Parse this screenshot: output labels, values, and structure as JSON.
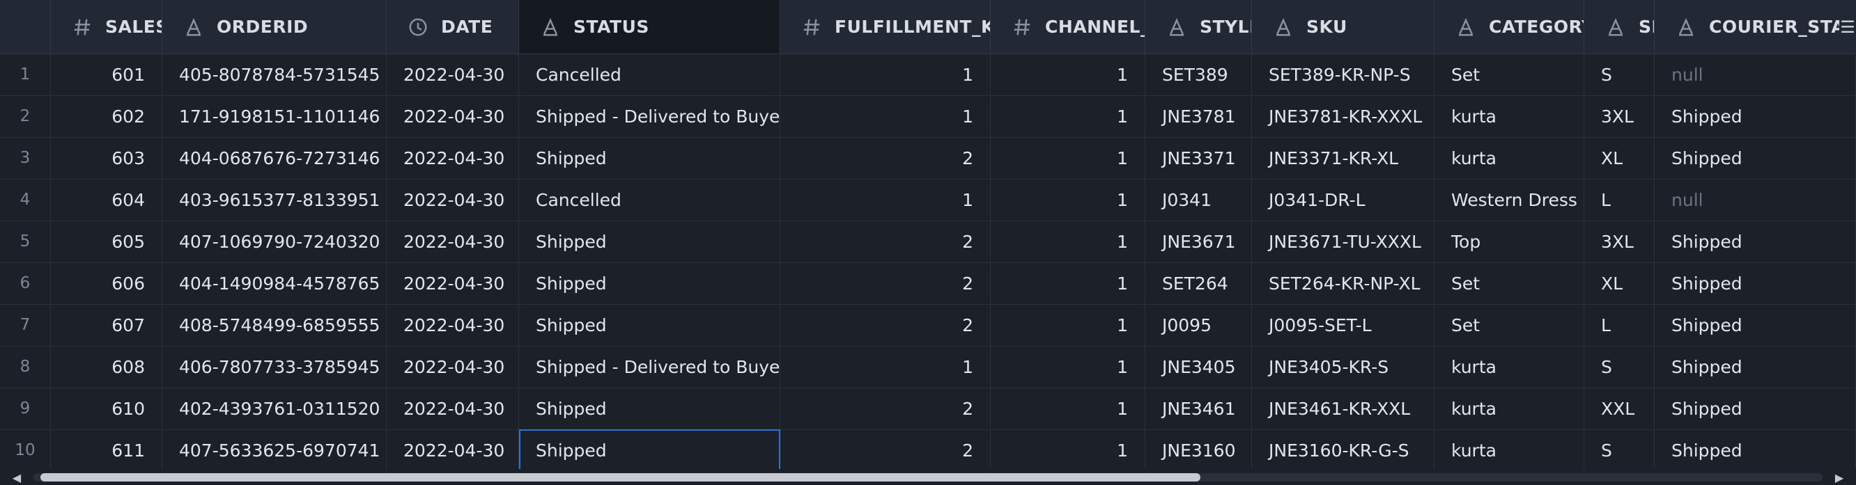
{
  "table": {
    "columns": [
      {
        "name": "SALES_",
        "type_icon": "hash-icon"
      },
      {
        "name": "ORDERID",
        "type_icon": "text-type-icon"
      },
      {
        "name": "DATE",
        "type_icon": "clock-icon"
      },
      {
        "name": "STATUS",
        "type_icon": "text-type-icon"
      },
      {
        "name": "FULFILLMENT_KEY",
        "type_icon": "hash-icon"
      },
      {
        "name": "CHANNEL_KE",
        "type_icon": "hash-icon"
      },
      {
        "name": "STYLE",
        "type_icon": "text-type-icon"
      },
      {
        "name": "SKU",
        "type_icon": "text-type-icon"
      },
      {
        "name": "CATEGORY",
        "type_icon": "text-type-icon"
      },
      {
        "name": "SIZ",
        "type_icon": "text-type-icon"
      },
      {
        "name": "COURIER_STATU",
        "type_icon": "text-type-icon"
      }
    ],
    "rows": [
      {
        "n": "1",
        "sales": "601",
        "orderid": "405-8078784-5731545",
        "date": "2022-04-30",
        "status": "Cancelled",
        "fulfillment": "1",
        "channel": "1",
        "style": "SET389",
        "sku": "SET389-KR-NP-S",
        "category": "Set",
        "size": "S",
        "courier": "null"
      },
      {
        "n": "2",
        "sales": "602",
        "orderid": "171-9198151-1101146",
        "date": "2022-04-30",
        "status": "Shipped - Delivered to Buyer",
        "fulfillment": "1",
        "channel": "1",
        "style": "JNE3781",
        "sku": "JNE3781-KR-XXXL",
        "category": "kurta",
        "size": "3XL",
        "courier": "Shipped"
      },
      {
        "n": "3",
        "sales": "603",
        "orderid": "404-0687676-7273146",
        "date": "2022-04-30",
        "status": "Shipped",
        "fulfillment": "2",
        "channel": "1",
        "style": "JNE3371",
        "sku": "JNE3371-KR-XL",
        "category": "kurta",
        "size": "XL",
        "courier": "Shipped"
      },
      {
        "n": "4",
        "sales": "604",
        "orderid": "403-9615377-8133951",
        "date": "2022-04-30",
        "status": "Cancelled",
        "fulfillment": "1",
        "channel": "1",
        "style": "J0341",
        "sku": "J0341-DR-L",
        "category": "Western Dress",
        "size": "L",
        "courier": "null"
      },
      {
        "n": "5",
        "sales": "605",
        "orderid": "407-1069790-7240320",
        "date": "2022-04-30",
        "status": "Shipped",
        "fulfillment": "2",
        "channel": "1",
        "style": "JNE3671",
        "sku": "JNE3671-TU-XXXL",
        "category": "Top",
        "size": "3XL",
        "courier": "Shipped"
      },
      {
        "n": "6",
        "sales": "606",
        "orderid": "404-1490984-4578765",
        "date": "2022-04-30",
        "status": "Shipped",
        "fulfillment": "2",
        "channel": "1",
        "style": "SET264",
        "sku": "SET264-KR-NP-XL",
        "category": "Set",
        "size": "XL",
        "courier": "Shipped"
      },
      {
        "n": "7",
        "sales": "607",
        "orderid": "408-5748499-6859555",
        "date": "2022-04-30",
        "status": "Shipped",
        "fulfillment": "2",
        "channel": "1",
        "style": "J0095",
        "sku": "J0095-SET-L",
        "category": "Set",
        "size": "L",
        "courier": "Shipped"
      },
      {
        "n": "8",
        "sales": "608",
        "orderid": "406-7807733-3785945",
        "date": "2022-04-30",
        "status": "Shipped - Delivered to Buyer",
        "fulfillment": "1",
        "channel": "1",
        "style": "JNE3405",
        "sku": "JNE3405-KR-S",
        "category": "kurta",
        "size": "S",
        "courier": "Shipped"
      },
      {
        "n": "9",
        "sales": "610",
        "orderid": "402-4393761-0311520",
        "date": "2022-04-30",
        "status": "Shipped",
        "fulfillment": "2",
        "channel": "1",
        "style": "JNE3461",
        "sku": "JNE3461-KR-XXL",
        "category": "kurta",
        "size": "XXL",
        "courier": "Shipped"
      },
      {
        "n": "10",
        "sales": "611",
        "orderid": "407-5633625-6970741",
        "date": "2022-04-30",
        "status": "Shipped",
        "fulfillment": "2",
        "channel": "1",
        "style": "JNE3160",
        "sku": "JNE3160-KR-G-S",
        "category": "kurta",
        "size": "S",
        "courier": "Shipped"
      }
    ]
  },
  "colors": {
    "background": "#1c2129",
    "header_background": "#232934",
    "active_header": "#151a21",
    "null_text": "#6c7380",
    "selection_border": "#2f74d0"
  },
  "ui": {
    "menu_icon": "hamburger-icon",
    "scroll_left_icon": "caret-left-icon",
    "scroll_right_icon": "caret-right-icon"
  }
}
